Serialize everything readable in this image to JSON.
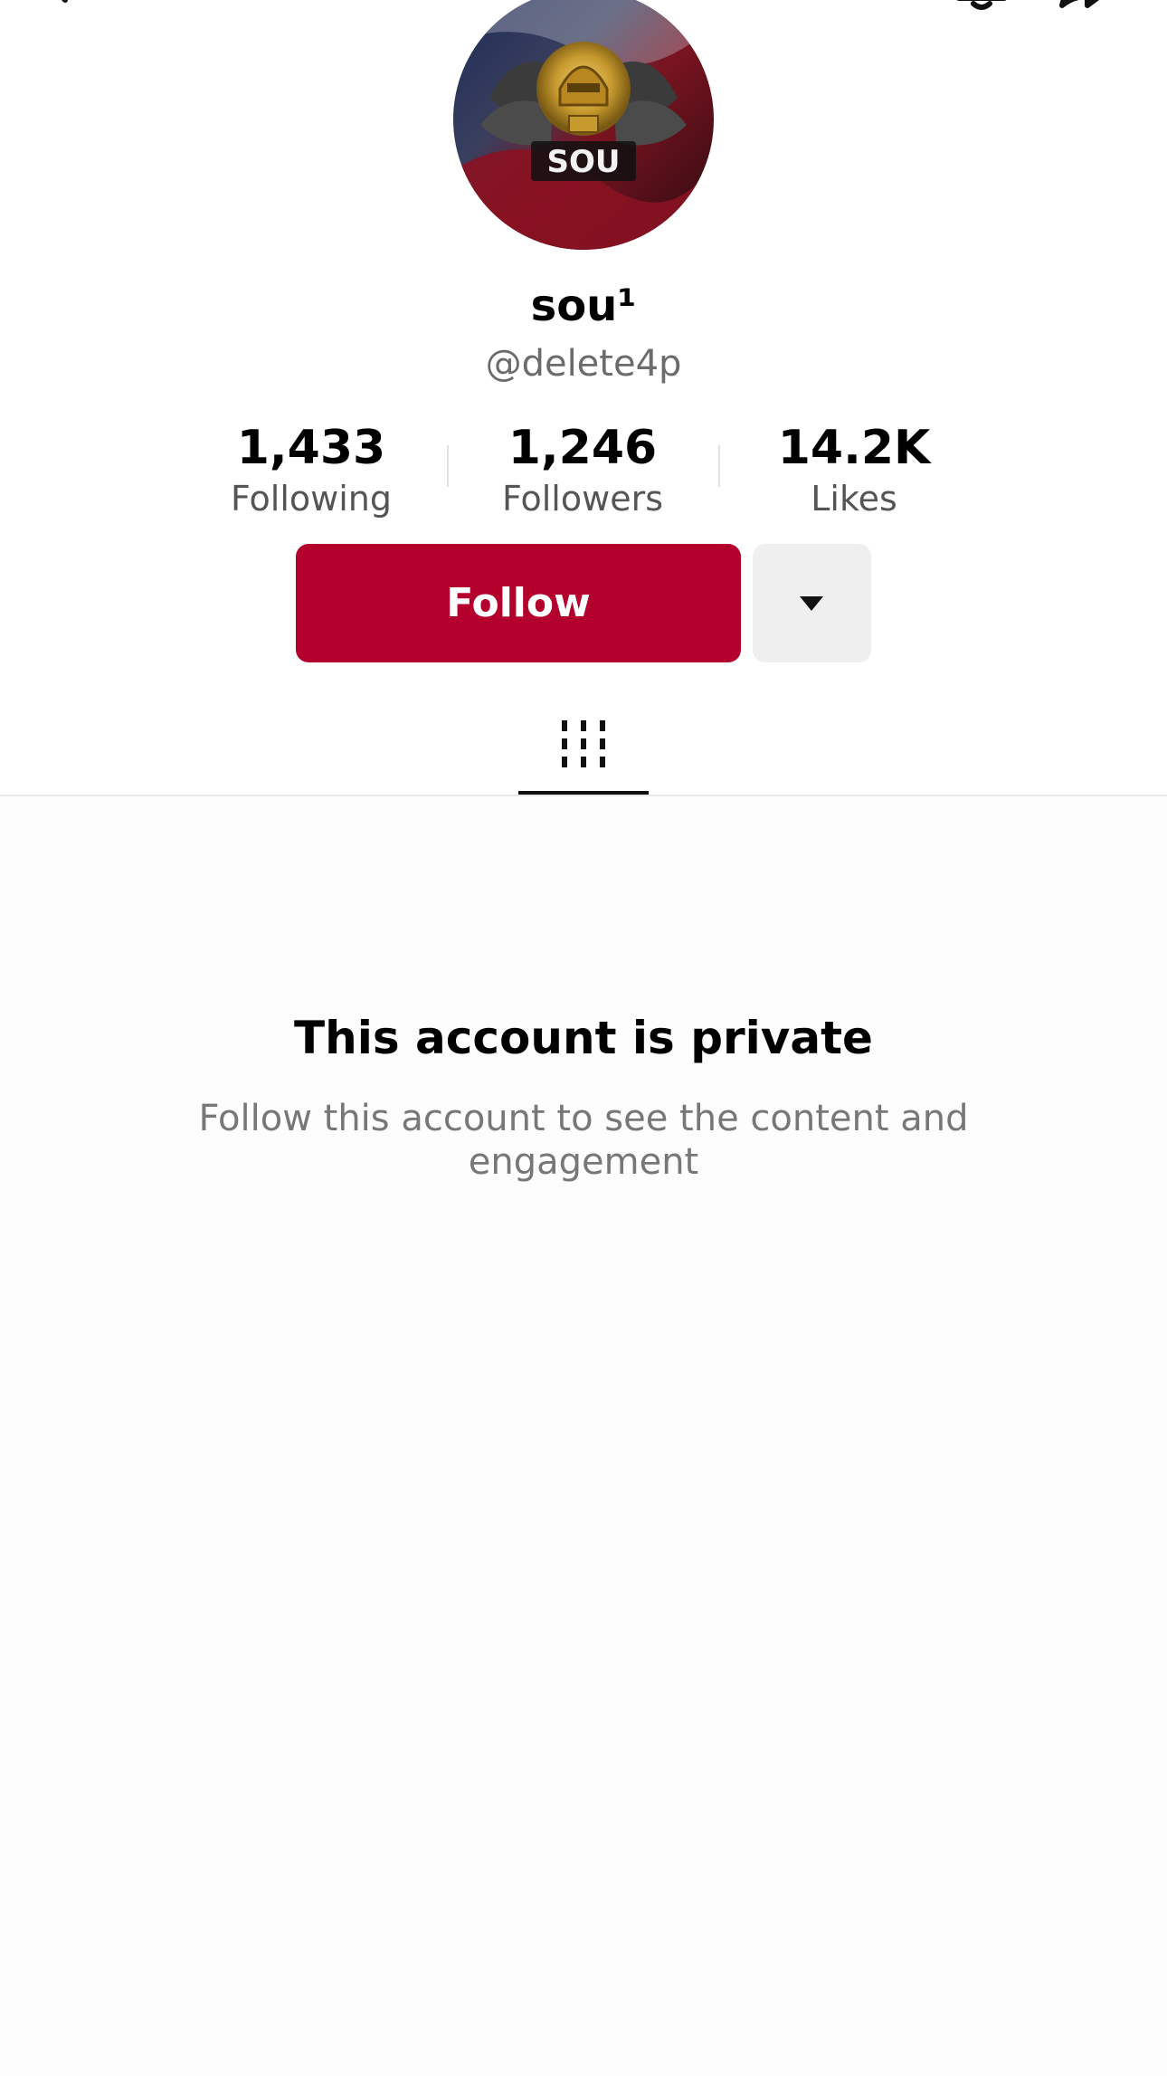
{
  "profile": {
    "display_name": "sou¹",
    "username": "@delete4p"
  },
  "stats": [
    {
      "value": "1,433",
      "label": "Following"
    },
    {
      "value": "1,246",
      "label": "Followers"
    },
    {
      "value": "14.2K",
      "label": "Likes"
    }
  ],
  "actions": {
    "follow_label": "Follow"
  },
  "private_notice": {
    "title": "This account is private",
    "description": "Follow this account to see the content and engagement"
  },
  "icons": {
    "back": "back-arrow-icon",
    "bell": "bell-icon",
    "share": "share-icon",
    "dropdown": "caret-down-icon",
    "videos_tab": "video-grid-icon"
  },
  "colors": {
    "accent": "#b3002d",
    "secondary_button": "#efefef",
    "muted_text": "#777777"
  }
}
